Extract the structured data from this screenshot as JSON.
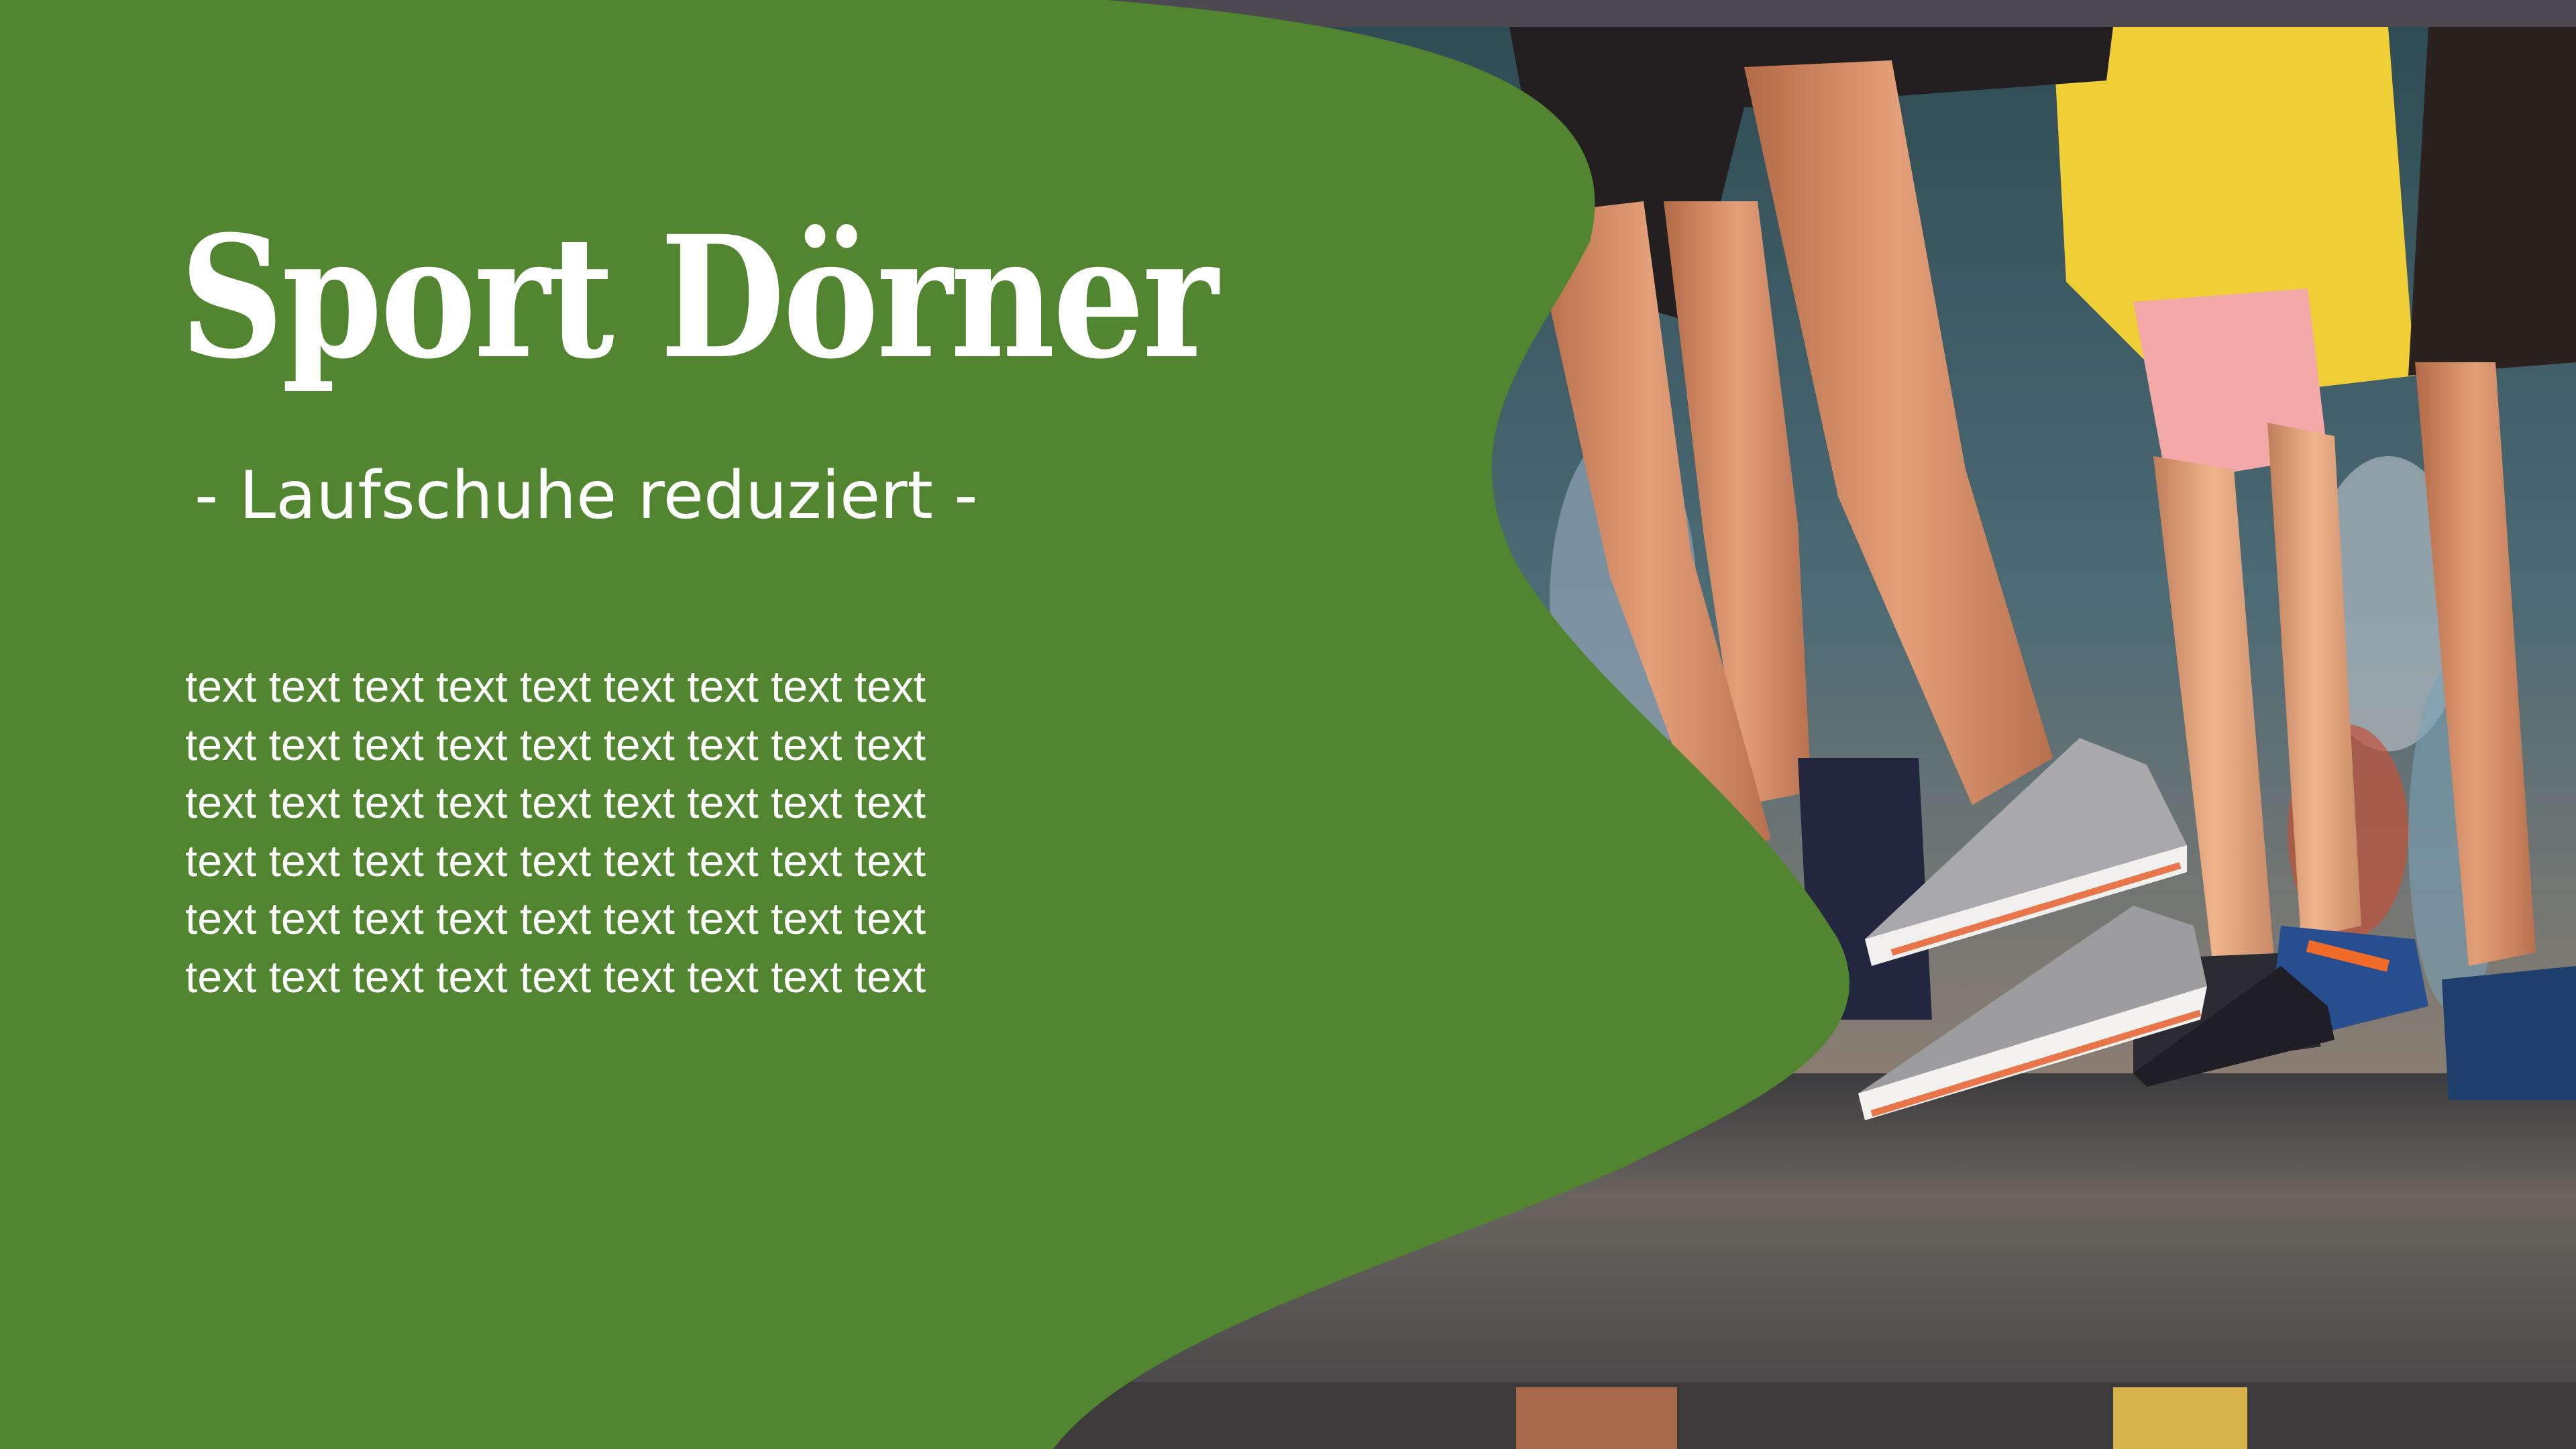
{
  "slide": {
    "title": "Sport Dörner",
    "subtitle": "- Laufschuhe reduziert -",
    "body_lines": [
      "text text text text text text text text text",
      "text text text text text text text text text",
      "text text text text text text text text text",
      "text text text text text text text text text",
      "text text text text text text text text text",
      "text text text text text text text text text"
    ]
  },
  "colors": {
    "green": "#52852f",
    "white": "#ffffff",
    "road": "#5e5b5a"
  },
  "photo": {
    "subject": "runners-legs-with-running-shoes"
  }
}
